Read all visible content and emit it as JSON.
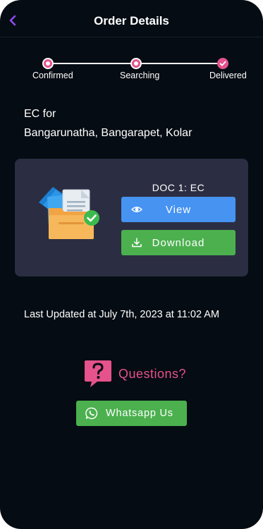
{
  "header": {
    "title": "Order Details",
    "back_icon": "chevron-left-icon",
    "back_color": "#8e4df0"
  },
  "tracker": {
    "steps": [
      {
        "label": "Confirmed",
        "state": "active"
      },
      {
        "label": "Searching",
        "state": "active"
      },
      {
        "label": "Delivered",
        "state": "completed"
      }
    ],
    "accent_color": "#e5528c"
  },
  "order": {
    "line1": "EC for",
    "line2": "Bangarunatha, Bangarapet, Kolar"
  },
  "document": {
    "title": "DOC 1: EC",
    "illustration_icon": "folder-documents-check-icon",
    "view_label": "View",
    "view_icon": "eye-icon",
    "view_color": "#4693f2",
    "download_label": "Download",
    "download_icon": "download-icon",
    "download_color": "#4cb04f"
  },
  "status": {
    "last_updated": "Last Updated at July 7th, 2023 at 11:02 AM"
  },
  "help": {
    "questions_label": "Questions?",
    "questions_icon": "question-bubble-icon",
    "whatsapp_label": "Whatsapp Us",
    "whatsapp_icon": "whatsapp-icon"
  }
}
